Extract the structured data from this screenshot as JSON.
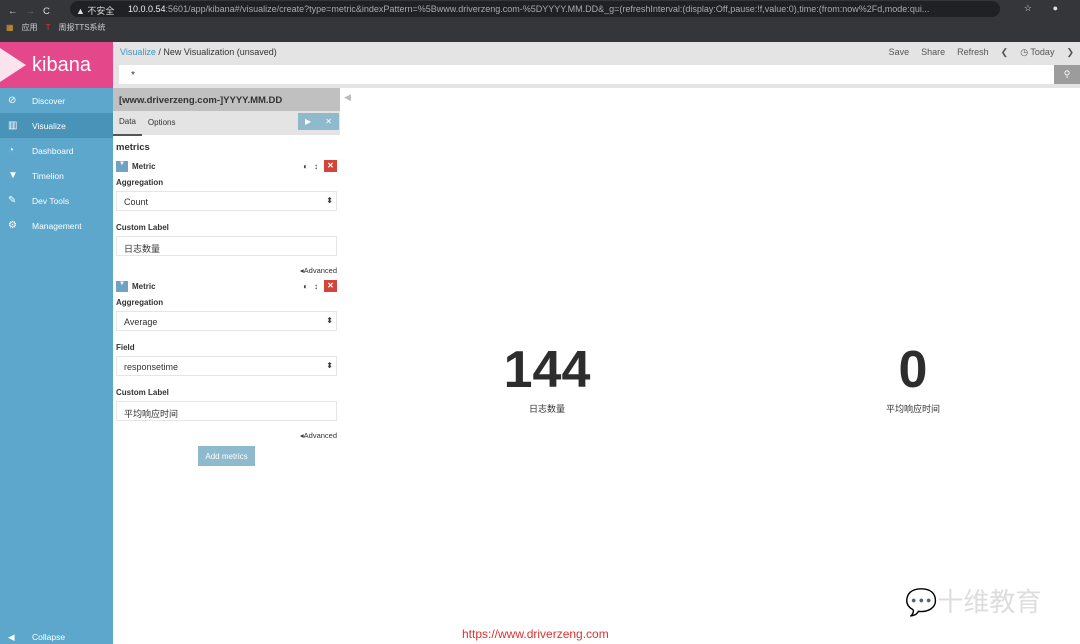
{
  "browser": {
    "security": "不安全",
    "url_host": "10.0.0.54",
    "url_rest": ":5601/app/kibana#/visualize/create?type=metric&indexPattern=%5Bwww.driverzeng.com-%5DYYYY.MM.DD&_g=(refreshInterval:(display:Off,pause:!f,value:0),time:(from:now%2Fd,mode:qui...",
    "bookmarks": [
      "应用",
      "周报TTS系统"
    ]
  },
  "sidebar": {
    "logo": "kibana",
    "items": [
      {
        "label": "Discover",
        "icon": "compass-icon"
      },
      {
        "label": "Visualize",
        "icon": "bar-chart-icon",
        "active": true
      },
      {
        "label": "Dashboard",
        "icon": "dashboard-icon"
      },
      {
        "label": "Timelion",
        "icon": "timelion-icon"
      },
      {
        "label": "Dev Tools",
        "icon": "wrench-icon"
      },
      {
        "label": "Management",
        "icon": "gear-icon"
      }
    ],
    "collapse": "Collapse"
  },
  "header": {
    "crumb_link": "Visualize",
    "crumb_sep": "/",
    "crumb_current": "New Visualization (unsaved)",
    "save": "Save",
    "share": "Share",
    "refresh": "Refresh",
    "today": "Today",
    "query": "*"
  },
  "editor": {
    "index_pattern": "[www.driverzeng.com-]YYYY.MM.DD",
    "tab_data": "Data",
    "tab_options": "Options",
    "section": "metrics",
    "metrics": [
      {
        "title": "Metric",
        "agg_label": "Aggregation",
        "agg": "Count",
        "custom_label_label": "Custom Label",
        "custom_label": "日志数量",
        "advanced": "Advanced"
      },
      {
        "title": "Metric",
        "agg_label": "Aggregation",
        "agg": "Average",
        "field_label": "Field",
        "field": "responsetime",
        "custom_label_label": "Custom Label",
        "custom_label": "平均响应时间",
        "advanced": "Advanced"
      }
    ],
    "add_metrics": "Add metrics"
  },
  "visualization": [
    {
      "value": "144",
      "label": "日志数量"
    },
    {
      "value": "0",
      "label": "平均响应时间"
    }
  ],
  "watermark": "十维教育",
  "footer_link": "https://www.driverzeng.com"
}
